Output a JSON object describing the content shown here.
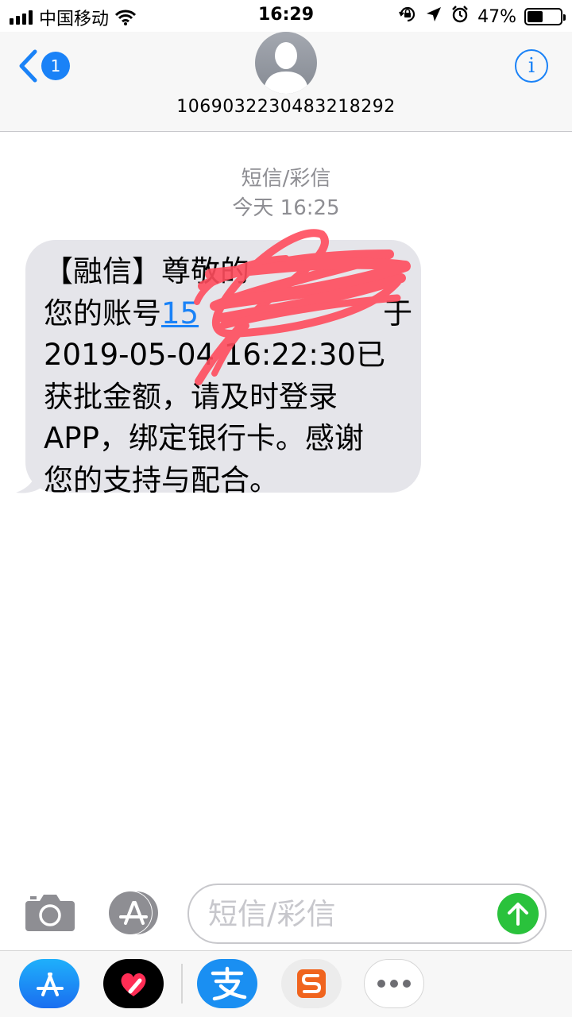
{
  "status_bar": {
    "carrier": "中国移动",
    "time": "16:29",
    "battery_percent": "47%",
    "battery_level": 0.47,
    "icons": [
      "signal-icon",
      "wifi-icon",
      "rotation-lock-icon",
      "location-icon",
      "alarm-icon",
      "battery-icon"
    ]
  },
  "nav": {
    "back_badge": "1",
    "contact_number": "1069032230483218292",
    "info_label": "i"
  },
  "thread": {
    "type_label": "短信/彩信",
    "timestamp": "今天 16:25"
  },
  "message": {
    "lines": [
      {
        "text": "【融信】尊敬的"
      },
      {
        "before": "您的账号",
        "link": "15",
        "after": "于"
      },
      {
        "text": "2019-05-04 16:22:30已"
      },
      {
        "text": "获批金额，请及时登录"
      },
      {
        "text": "APP，绑定银行卡。感谢"
      },
      {
        "text": "您的支持与配合。"
      }
    ]
  },
  "composer": {
    "placeholder": "短信/彩信"
  },
  "app_drawer": {
    "apps": [
      "app-store-icon",
      "digital-touch-icon",
      "alipay-icon",
      "sogou-icon",
      "more-icon"
    ],
    "colors": {
      "app_store": "#1a82f7",
      "alipay": "#1a8ff2",
      "sogou": "#f0641e",
      "send": "#2ac23c",
      "heart": "#ff2d55"
    }
  }
}
